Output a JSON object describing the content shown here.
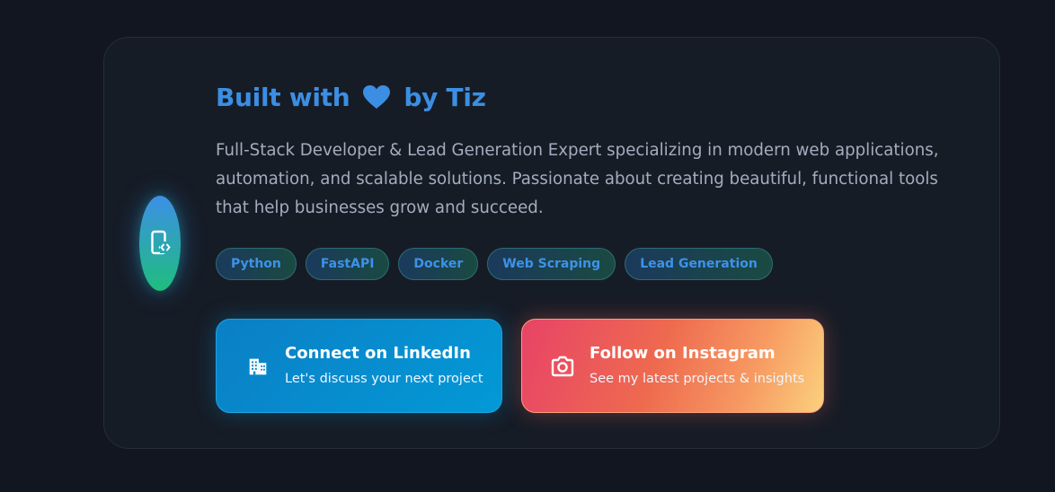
{
  "profile": {
    "avatar_icon": "mobile-code-icon",
    "title_prefix": "Built with",
    "title_icon": "heart-icon",
    "title_suffix": "by Tiz",
    "description": "Full-Stack Developer & Lead Generation Expert specializing in modern web applications, automation, and scalable solutions. Passionate about creating beautiful, functional tools that help businesses grow and succeed.",
    "tags": [
      "Python",
      "FastAPI",
      "Docker",
      "Web Scraping",
      "Lead Generation"
    ]
  },
  "buttons": {
    "linkedin": {
      "icon": "building-icon",
      "label": "Connect on LinkedIn",
      "sublabel": "Let's discuss your next project"
    },
    "instagram": {
      "icon": "camera-icon",
      "label": "Follow on Instagram",
      "sublabel": "See my latest projects & insights"
    }
  },
  "colors": {
    "background": "#111620",
    "card": "#161c26",
    "accent_blue": "#3b8ee2",
    "accent_green": "#1fbd7e",
    "linkedin_blue": "#0399d6",
    "instagram_pink": "#e84367",
    "instagram_yellow": "#fbd17d"
  }
}
